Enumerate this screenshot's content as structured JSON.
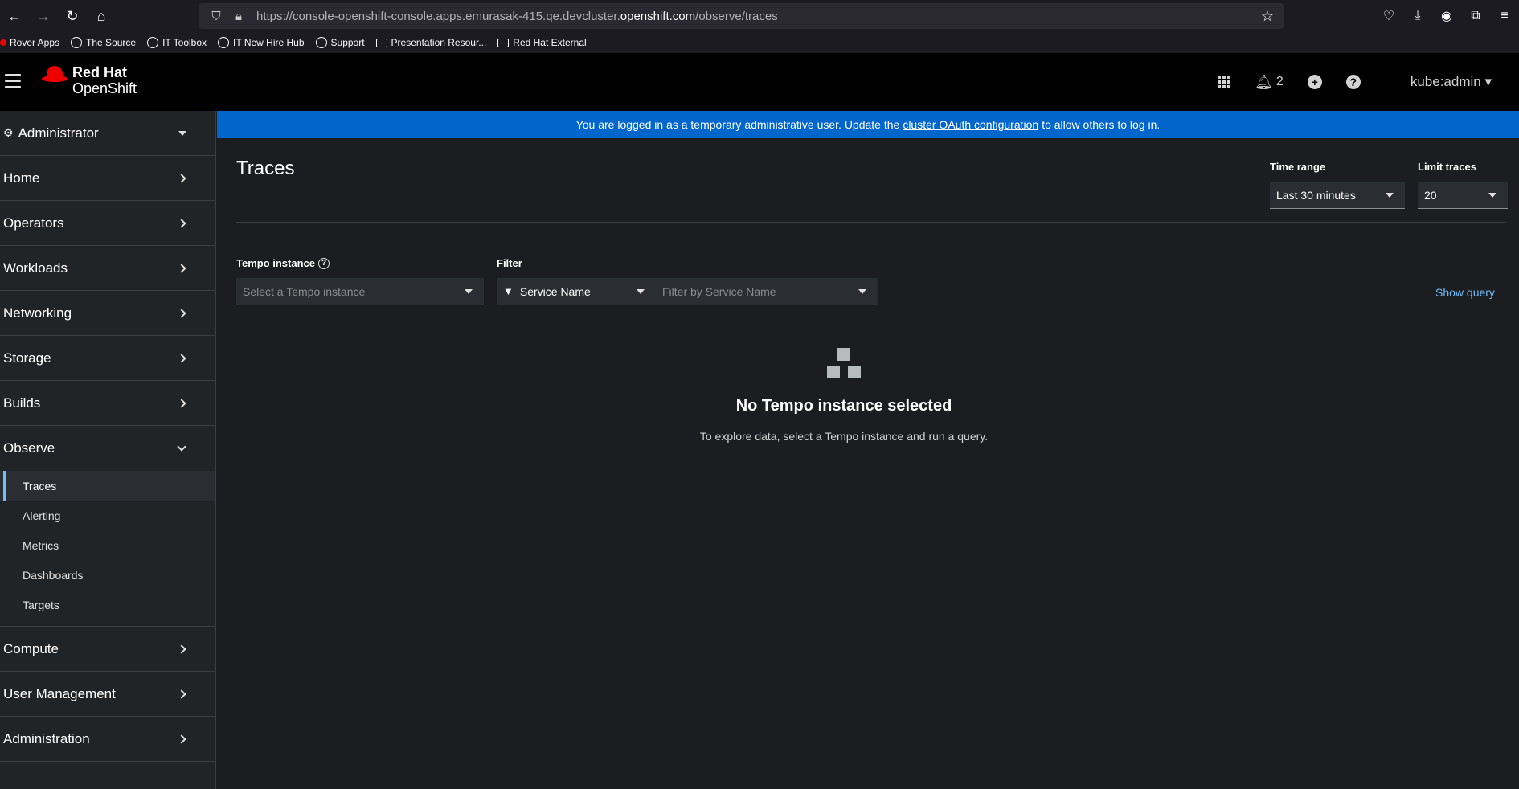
{
  "browser": {
    "url_prefix": "https://console-openshift-console.apps.emurasak-415.qe.devcluster.",
    "url_host": "openshift.com",
    "url_path": "/observe/traces"
  },
  "bookmarks": [
    {
      "label": "Rover Apps",
      "icon": "redhat"
    },
    {
      "label": "The Source",
      "icon": "globe"
    },
    {
      "label": "IT Toolbox",
      "icon": "globe"
    },
    {
      "label": "IT New Hire Hub",
      "icon": "globe"
    },
    {
      "label": "Support",
      "icon": "globe"
    },
    {
      "label": "Presentation Resour...",
      "icon": "folder"
    },
    {
      "label": "Red Hat External",
      "icon": "folder"
    }
  ],
  "masthead": {
    "logo_line1": "Red Hat",
    "logo_line2": "OpenShift",
    "notifications_count": "2",
    "user": "kube:admin"
  },
  "sidebar": {
    "perspective": "Administrator",
    "items": [
      {
        "label": "Home"
      },
      {
        "label": "Operators"
      },
      {
        "label": "Workloads"
      },
      {
        "label": "Networking"
      },
      {
        "label": "Storage"
      },
      {
        "label": "Builds"
      },
      {
        "label": "Observe"
      },
      {
        "label": "Compute"
      },
      {
        "label": "User Management"
      },
      {
        "label": "Administration"
      }
    ],
    "observe_sub": [
      {
        "label": "Traces"
      },
      {
        "label": "Alerting"
      },
      {
        "label": "Metrics"
      },
      {
        "label": "Dashboards"
      },
      {
        "label": "Targets"
      }
    ]
  },
  "banner": {
    "text_before": "You are logged in as a temporary administrative user. Update the",
    "link": "cluster OAuth configuration",
    "text_after": "to allow others to log in."
  },
  "page": {
    "title": "Traces",
    "time_range_label": "Time range",
    "time_range_value": "Last 30 minutes",
    "limit_label": "Limit traces",
    "limit_value": "20",
    "tempo_label": "Tempo instance",
    "tempo_placeholder": "Select a Tempo instance",
    "filter_label": "Filter",
    "filter_type": "Service Name",
    "filter_placeholder": "Filter by Service Name",
    "show_query": "Show query",
    "empty_title": "No Tempo instance selected",
    "empty_body": "To explore data, select a Tempo instance and run a query."
  }
}
